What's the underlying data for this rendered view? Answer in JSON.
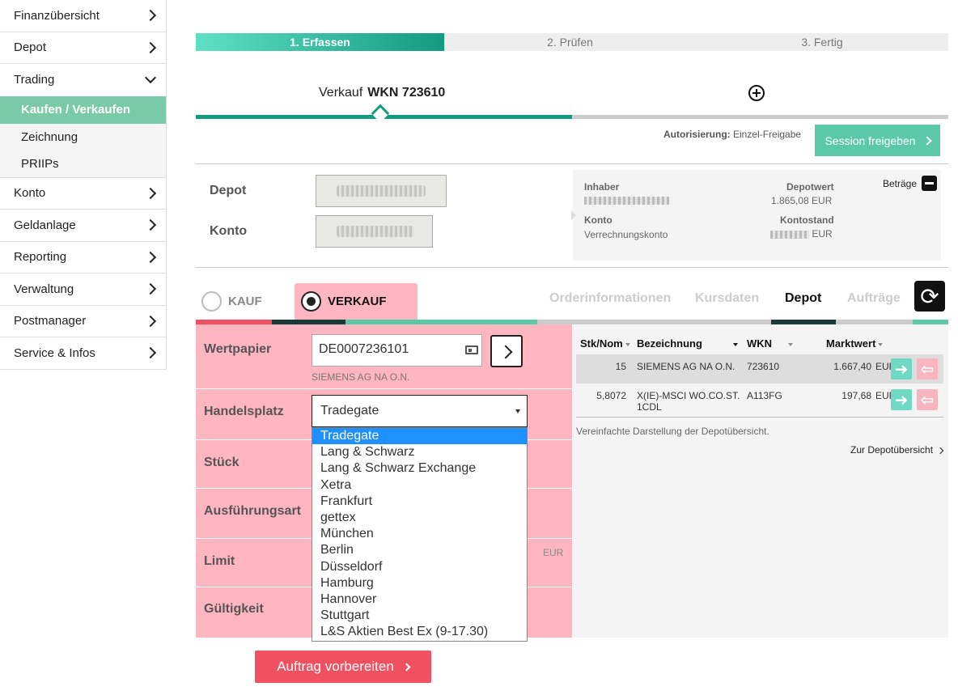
{
  "sidebar": {
    "items": [
      {
        "label": "Finanzübersicht"
      },
      {
        "label": "Depot"
      },
      {
        "label": "Trading"
      },
      {
        "label": "Konto"
      },
      {
        "label": "Geldanlage"
      },
      {
        "label": "Reporting"
      },
      {
        "label": "Verwaltung"
      },
      {
        "label": "Postmanager"
      },
      {
        "label": "Service & Infos"
      }
    ],
    "trading_sub": [
      {
        "label": "Kaufen / Verkaufen",
        "active": true
      },
      {
        "label": "Zeichnung"
      },
      {
        "label": "PRIIPs"
      }
    ]
  },
  "stepper": {
    "steps": [
      "1. Erfassen",
      "2. Prüfen",
      "3. Fertig"
    ],
    "active": 0
  },
  "order_tab": {
    "prefix": "Verkauf",
    "wkn": "WKN 723610"
  },
  "authorization": {
    "label": "Autorisierung:",
    "value": "Einzel-Freigabe"
  },
  "session_button": "Session freigeben",
  "accounts": {
    "depot_label": "Depot",
    "konto_label": "Konto"
  },
  "info": {
    "inhaber_label": "Inhaber",
    "depotwert_label": "Depotwert",
    "depotwert_value": "1.865,08  EUR",
    "konto_label": "Konto",
    "konto_value": "Verrechnungskonto",
    "kontostand_label": "Kontostand",
    "kontostand_currency": "EUR",
    "betraege_label": "Beträge"
  },
  "trade_type": {
    "kauf": "KAUF",
    "verkauf": "VERKAUF",
    "selected": "verkauf"
  },
  "right_tabs": [
    "Orderinformationen",
    "Kursdaten",
    "Depot",
    "Aufträge"
  ],
  "form": {
    "wertpapier_label": "Wertpapier",
    "wertpapier_value": "DE0007236101",
    "wertpapier_name": "SIEMENS AG NA O.N.",
    "handelsplatz_label": "Handelsplatz",
    "handelsplatz_value": "Tradegate",
    "stueck_label": "Stück",
    "ausfuehrung_label": "Ausführungsart",
    "limit_label": "Limit",
    "limit_currency": "EUR",
    "gueltigkeit_label": "Gültigkeit"
  },
  "handelsplatz_options": [
    "Tradegate",
    "Lang & Schwarz",
    "Lang & Schwarz Exchange",
    "Xetra",
    "Frankfurt",
    "gettex",
    "München",
    "Berlin",
    "Düsseldorf",
    "Hamburg",
    "Hannover",
    "Stuttgart",
    "L&S Aktien Best Ex (9-17.30)"
  ],
  "depot_table": {
    "headers": [
      "Stk/Nom",
      "Bezeichnung",
      "WKN",
      "Marktwert"
    ],
    "rows": [
      {
        "qty": "15",
        "name": "SIEMENS AG NA O.N.",
        "wkn": "723610",
        "value": "1.667,40",
        "currency": "EUR"
      },
      {
        "qty": "5,8072",
        "name": "X(IE)-MSCI WO.CO.ST. 1CDL",
        "wkn": "A113FG",
        "value": "197,68",
        "currency": "EUR"
      }
    ],
    "note": "Vereinfachte Darstellung der Depotübersicht.",
    "link": "Zur Depotübersicht"
  },
  "submit_button": "Auftrag vorbereiten",
  "colors": {
    "accent": "#139a81",
    "sell": "#ffb6c1",
    "submit": "#f05161",
    "session": "#5bc8a8"
  }
}
